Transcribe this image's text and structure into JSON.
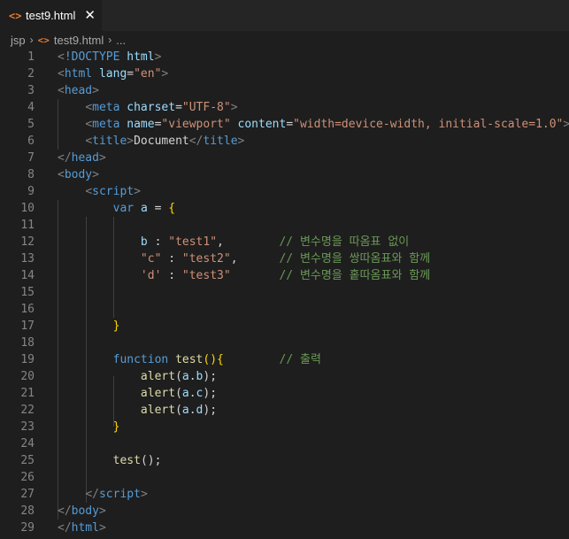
{
  "tab": {
    "icon": "<>",
    "label": "test9.html",
    "close": "✕"
  },
  "breadcrumb": {
    "folder": "jsp",
    "file_icon": "<>",
    "file": "test9.html",
    "more": "..."
  },
  "lines": [
    {
      "n": "1",
      "tokens": [
        [
          "punc",
          "<"
        ],
        [
          "tag",
          "!DOCTYPE "
        ],
        [
          "attr",
          "html"
        ],
        [
          "punc",
          ">"
        ]
      ]
    },
    {
      "n": "2",
      "tokens": [
        [
          "punc",
          "<"
        ],
        [
          "tag",
          "html "
        ],
        [
          "attr",
          "lang"
        ],
        [
          "def",
          "="
        ],
        [
          "str",
          "\"en\""
        ],
        [
          "punc",
          ">"
        ]
      ]
    },
    {
      "n": "3",
      "tokens": [
        [
          "punc",
          "<"
        ],
        [
          "tag",
          "head"
        ],
        [
          "punc",
          ">"
        ]
      ]
    },
    {
      "n": "4",
      "tokens": [
        [
          "def",
          "    "
        ],
        [
          "punc",
          "<"
        ],
        [
          "tag",
          "meta "
        ],
        [
          "attr",
          "charset"
        ],
        [
          "def",
          "="
        ],
        [
          "str",
          "\"UTF-8\""
        ],
        [
          "punc",
          ">"
        ]
      ]
    },
    {
      "n": "5",
      "tokens": [
        [
          "def",
          "    "
        ],
        [
          "punc",
          "<"
        ],
        [
          "tag",
          "meta "
        ],
        [
          "attr",
          "name"
        ],
        [
          "def",
          "="
        ],
        [
          "str",
          "\"viewport\" "
        ],
        [
          "attr",
          "content"
        ],
        [
          "def",
          "="
        ],
        [
          "str",
          "\"width=device-width, initial-scale=1.0\""
        ],
        [
          "punc",
          ">"
        ]
      ]
    },
    {
      "n": "6",
      "tokens": [
        [
          "def",
          "    "
        ],
        [
          "punc",
          "<"
        ],
        [
          "tag",
          "title"
        ],
        [
          "punc",
          ">"
        ],
        [
          "def",
          "Document"
        ],
        [
          "punc",
          "</"
        ],
        [
          "tag",
          "title"
        ],
        [
          "punc",
          ">"
        ]
      ]
    },
    {
      "n": "7",
      "tokens": [
        [
          "punc",
          "</"
        ],
        [
          "tag",
          "head"
        ],
        [
          "punc",
          ">"
        ]
      ]
    },
    {
      "n": "8",
      "tokens": [
        [
          "punc",
          "<"
        ],
        [
          "tag",
          "body"
        ],
        [
          "punc",
          ">"
        ]
      ]
    },
    {
      "n": "9",
      "tokens": [
        [
          "def",
          "    "
        ],
        [
          "punc",
          "<"
        ],
        [
          "tag",
          "script"
        ],
        [
          "punc",
          ">"
        ]
      ]
    },
    {
      "n": "10",
      "tokens": [
        [
          "def",
          "        "
        ],
        [
          "kw",
          "var "
        ],
        [
          "var",
          "a"
        ],
        [
          "def",
          " = "
        ],
        [
          "brace",
          "{"
        ]
      ]
    },
    {
      "n": "11",
      "tokens": []
    },
    {
      "n": "12",
      "tokens": [
        [
          "def",
          "            "
        ],
        [
          "var",
          "b"
        ],
        [
          "def",
          " : "
        ],
        [
          "str",
          "\"test1\""
        ],
        [
          "def",
          ",        "
        ],
        [
          "cmt",
          "// 변수명을 따옴표 없이"
        ]
      ]
    },
    {
      "n": "13",
      "tokens": [
        [
          "def",
          "            "
        ],
        [
          "str",
          "\"c\""
        ],
        [
          "def",
          " : "
        ],
        [
          "str",
          "\"test2\""
        ],
        [
          "def",
          ",      "
        ],
        [
          "cmt",
          "// 변수명을 쌍따옴표와 함께"
        ]
      ]
    },
    {
      "n": "14",
      "tokens": [
        [
          "def",
          "            "
        ],
        [
          "str",
          "'d'"
        ],
        [
          "def",
          " : "
        ],
        [
          "str",
          "\"test3\""
        ],
        [
          "def",
          "       "
        ],
        [
          "cmt",
          "// 변수명을 홑따옴표와 함께"
        ]
      ]
    },
    {
      "n": "15",
      "tokens": []
    },
    {
      "n": "16",
      "tokens": []
    },
    {
      "n": "17",
      "tokens": [
        [
          "def",
          "        "
        ],
        [
          "brace",
          "}"
        ]
      ]
    },
    {
      "n": "18",
      "tokens": []
    },
    {
      "n": "19",
      "tokens": [
        [
          "def",
          "        "
        ],
        [
          "kw",
          "function "
        ],
        [
          "fn",
          "test"
        ],
        [
          "brace",
          "()"
        ],
        [
          "brace",
          "{"
        ],
        [
          "def",
          "        "
        ],
        [
          "cmt",
          "// 출력"
        ]
      ]
    },
    {
      "n": "20",
      "tokens": [
        [
          "def",
          "            "
        ],
        [
          "fn",
          "alert"
        ],
        [
          "def",
          "("
        ],
        [
          "var",
          "a"
        ],
        [
          "def",
          "."
        ],
        [
          "var",
          "b"
        ],
        [
          "def",
          ");"
        ]
      ]
    },
    {
      "n": "21",
      "tokens": [
        [
          "def",
          "            "
        ],
        [
          "fn",
          "alert"
        ],
        [
          "def",
          "("
        ],
        [
          "var",
          "a"
        ],
        [
          "def",
          "."
        ],
        [
          "var",
          "c"
        ],
        [
          "def",
          ");"
        ]
      ]
    },
    {
      "n": "22",
      "tokens": [
        [
          "def",
          "            "
        ],
        [
          "fn",
          "alert"
        ],
        [
          "def",
          "("
        ],
        [
          "var",
          "a"
        ],
        [
          "def",
          "."
        ],
        [
          "var",
          "d"
        ],
        [
          "def",
          ");"
        ]
      ]
    },
    {
      "n": "23",
      "tokens": [
        [
          "def",
          "        "
        ],
        [
          "brace",
          "}"
        ]
      ]
    },
    {
      "n": "24",
      "tokens": []
    },
    {
      "n": "25",
      "tokens": [
        [
          "def",
          "        "
        ],
        [
          "fn",
          "test"
        ],
        [
          "def",
          "();"
        ]
      ]
    },
    {
      "n": "26",
      "tokens": []
    },
    {
      "n": "27",
      "tokens": [
        [
          "def",
          "    "
        ],
        [
          "punc",
          "</"
        ],
        [
          "tag",
          "script"
        ],
        [
          "punc",
          ">"
        ]
      ]
    },
    {
      "n": "28",
      "tokens": [
        [
          "punc",
          "</"
        ],
        [
          "tag",
          "body"
        ],
        [
          "punc",
          ">"
        ]
      ]
    },
    {
      "n": "29",
      "tokens": [
        [
          "punc",
          "</"
        ],
        [
          "tag",
          "html"
        ],
        [
          "punc",
          ">"
        ]
      ]
    }
  ],
  "colors": {
    "background": "#1e1e1e",
    "tab_icon": "#e37933",
    "tag": "#569cd6",
    "attribute": "#9cdcfe",
    "string": "#ce9178",
    "comment": "#6a9955",
    "function": "#dcdcaa",
    "bracket": "#ffd700",
    "line_number": "#858585"
  }
}
